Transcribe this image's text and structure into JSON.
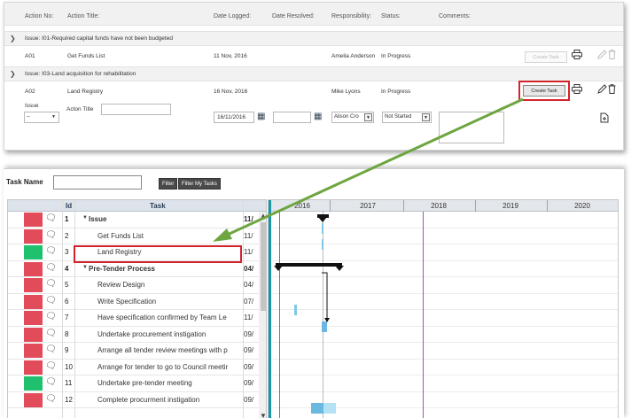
{
  "action_panel": {
    "headers": {
      "action_no": "Action No:",
      "action_title": "Action Title:",
      "date_logged": "Date Logged:",
      "date_resolved": "Date Resolved:",
      "responsibility": "Responsibility:",
      "status": "Status:",
      "comments": "Comments:"
    },
    "issues": [
      {
        "title": "Issue: I01-Required capital funds have not been budgeted",
        "action": {
          "no": "A01",
          "title": "Get Funds List",
          "date_logged": "11 Nov, 2016",
          "responsibility": "Amelia Anderson",
          "status": "In Progress",
          "button": "Create Task"
        }
      },
      {
        "title": "Issue: I03-Land acquisition for rehabilitation",
        "action": {
          "no": "A02",
          "title": "Land Registry",
          "date_logged": "16 Nov, 2016",
          "responsibility": "Mike Lyons",
          "status": "In Progress",
          "button": "Create Task"
        }
      }
    ],
    "form": {
      "issue_label": "Issue",
      "issue_value": "--",
      "title_label": "Acton Title",
      "date_logged": "16/11/2016",
      "responsibility": "Alison Cro",
      "status": "Not Started"
    }
  },
  "gantt": {
    "task_name_label": "Task Name",
    "filter_button": "Filter",
    "filter_my_button": "Filter My Tasks",
    "columns": {
      "id": "Id",
      "task": "Task"
    },
    "years": [
      "2016",
      "2017",
      "2018",
      "2019",
      "2020"
    ],
    "status_colors": {
      "red": "#e24c5a",
      "green": "#1fc06e"
    },
    "rows": [
      {
        "id": "1",
        "name": "Issue",
        "date": "11/",
        "status": "red",
        "group": true,
        "indent": 0
      },
      {
        "id": "2",
        "name": "Get Funds List",
        "date": "11/",
        "status": "red",
        "group": false,
        "indent": 1
      },
      {
        "id": "3",
        "name": "Land Registry",
        "date": "11/",
        "status": "green",
        "group": false,
        "indent": 1
      },
      {
        "id": "4",
        "name": "Pre-Tender Process",
        "date": "04/",
        "status": "red",
        "group": true,
        "indent": 0
      },
      {
        "id": "5",
        "name": "Review Design",
        "date": "04/",
        "status": "red",
        "group": false,
        "indent": 1
      },
      {
        "id": "6",
        "name": "Write Specification",
        "date": "07/",
        "status": "red",
        "group": false,
        "indent": 1
      },
      {
        "id": "7",
        "name": "Have specification confirmed by Team Le",
        "date": "11/",
        "status": "red",
        "group": false,
        "indent": 1
      },
      {
        "id": "8",
        "name": "Undertake procurement instigation",
        "date": "09/",
        "status": "red",
        "group": false,
        "indent": 1
      },
      {
        "id": "9",
        "name": "Arrange all tender review meetings with p",
        "date": "09/",
        "status": "red",
        "group": false,
        "indent": 1
      },
      {
        "id": "10",
        "name": "Arrange for tender to go to Council meetir",
        "date": "09/",
        "status": "red",
        "group": false,
        "indent": 1
      },
      {
        "id": "11",
        "name": "Undertake pre-tender meeting",
        "date": "09/",
        "status": "green",
        "group": false,
        "indent": 1
      },
      {
        "id": "12",
        "name": "Complete procurment instigation",
        "date": "09/",
        "status": "red",
        "group": false,
        "indent": 1
      }
    ]
  }
}
